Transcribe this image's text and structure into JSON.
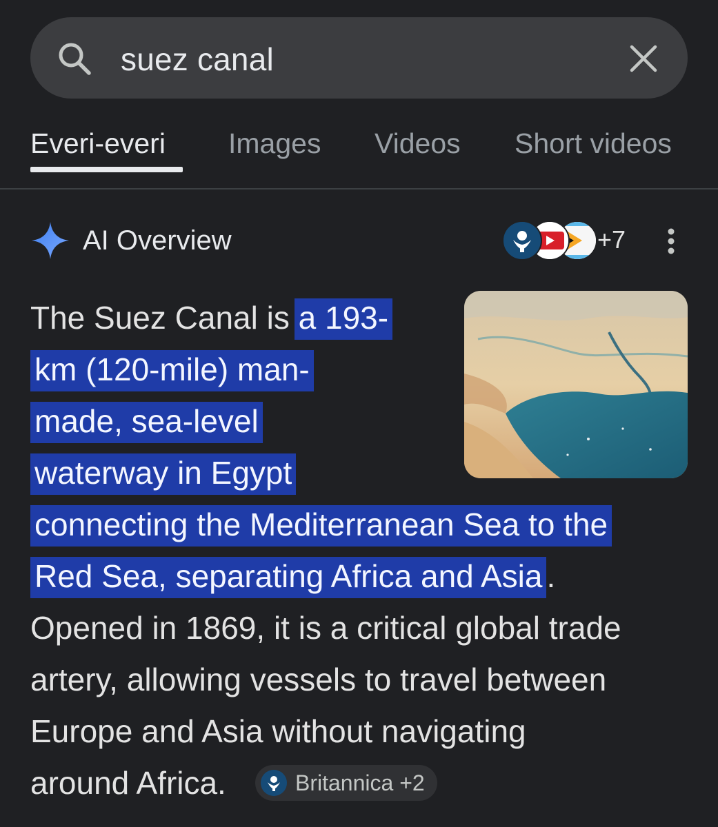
{
  "search": {
    "query": "suez canal",
    "search_icon": "search-icon",
    "clear_icon": "close-icon"
  },
  "tabs": [
    {
      "label": "Everi-everi",
      "active": true
    },
    {
      "label": "Images",
      "active": false
    },
    {
      "label": "Videos",
      "active": false
    },
    {
      "label": "Short videos",
      "active": false
    }
  ],
  "ai_overview": {
    "title": "AI Overview",
    "sparkle_icon": "sparkle-icon",
    "sources_more": "+7",
    "more_icon": "more-vert-icon",
    "thumbnail": "aerial-photo-suez-canal",
    "text_lines": [
      {
        "plain": "The Suez Canal is ",
        "highlight": "a 193-"
      },
      {
        "plain": "",
        "highlight": "km (120-mile) man-"
      },
      {
        "plain": "",
        "highlight": "made, sea-level"
      },
      {
        "plain": "",
        "highlight": "waterway in Egypt"
      },
      {
        "plain": "",
        "highlight": "connecting the Mediterranean Sea to the"
      },
      {
        "plain": "",
        "highlight": "Red Sea, separating Africa and Asia",
        "after": "."
      },
      {
        "plain": "Opened in 1869, it is a critical global trade"
      },
      {
        "plain": "artery, allowing vessels to travel between"
      },
      {
        "plain": "Europe and Asia without navigating"
      },
      {
        "plain": "around Africa."
      }
    ],
    "citation": {
      "label": "Britannica +2",
      "logo_icon": "britannica-logo-icon"
    }
  },
  "colors": {
    "background": "#1f2023",
    "search_bar": "#3c3d40",
    "highlight": "#1f3ca8",
    "sparkle": "#4c8df6"
  }
}
